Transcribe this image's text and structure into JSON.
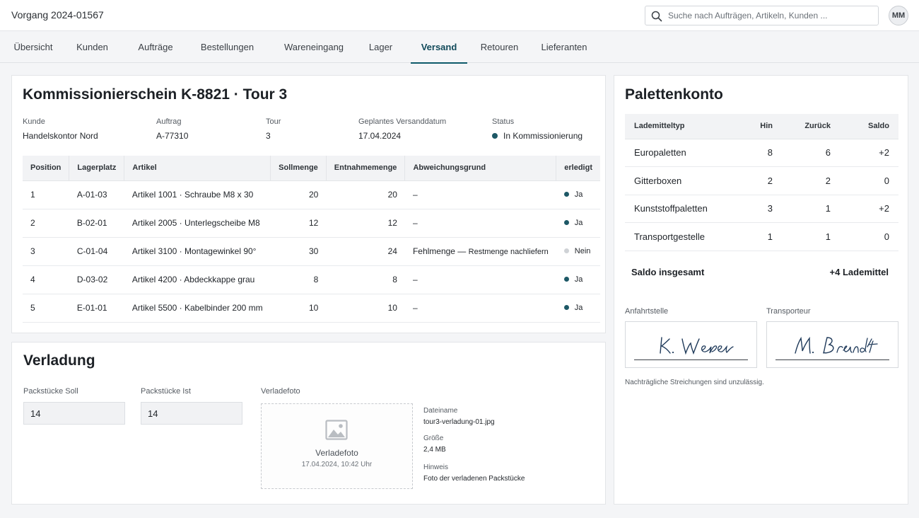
{
  "app": {
    "title": "Vorgang 2024-01567",
    "avatar_initials": "MM"
  },
  "search": {
    "placeholder": "Suche nach Aufträgen, Artikeln, Kunden ...",
    "value": ""
  },
  "tabs": [
    {
      "label": "Übersicht"
    },
    {
      "label": "Kunden"
    },
    {
      "label": "Aufträge"
    },
    {
      "label": "Bestellungen"
    },
    {
      "label": "Wareneingang"
    },
    {
      "label": "Lager"
    },
    {
      "label": "Versand",
      "active": true
    },
    {
      "label": "Retouren"
    },
    {
      "label": "Lieferanten"
    }
  ],
  "picking": {
    "title": "Kommissionierschein K-8821 · Tour 3",
    "meta": {
      "kunde_label": "Kunde",
      "kunde": "Handelskontor Nord",
      "auftrag_label": "Auftrag",
      "auftrag": "A-77310",
      "tour_label": "Tour",
      "tour": "3",
      "datum_label": "Geplantes Versanddatum",
      "datum": "17.04.2024",
      "status_label": "Status",
      "status": "In Kommissionierung"
    },
    "columns": [
      "Position",
      "Lagerplatz",
      "Artikel",
      "Sollmenge",
      "Entnahmemenge",
      "Abweichungsgrund",
      "erledigt"
    ],
    "rows": [
      {
        "pos": "1",
        "platz": "A-01-03",
        "artikel": "Artikel 1001 · Schraube M8 x 30",
        "soll": "20",
        "ist": "20",
        "grund": "–",
        "grund_note": "",
        "erledigt": "Ja",
        "done": true
      },
      {
        "pos": "2",
        "platz": "B-02-01",
        "artikel": "Artikel 2005 · Unterlegscheibe M8",
        "soll": "12",
        "ist": "12",
        "grund": "–",
        "grund_note": "",
        "erledigt": "Ja",
        "done": true
      },
      {
        "pos": "3",
        "platz": "C-01-04",
        "artikel": "Artikel 3100 · Montagewinkel 90°",
        "soll": "30",
        "ist": "24",
        "grund": "Fehlmenge — ",
        "grund_note": "Restmenge nachliefern",
        "erledigt": "Nein",
        "done": false
      },
      {
        "pos": "4",
        "platz": "D-03-02",
        "artikel": "Artikel 4200 · Abdeckkappe grau",
        "soll": "8",
        "ist": "8",
        "grund": "–",
        "grund_note": "",
        "erledigt": "Ja",
        "done": true
      },
      {
        "pos": "5",
        "platz": "E-01-01",
        "artikel": "Artikel 5500 · Kabelbinder 200 mm",
        "soll": "10",
        "ist": "10",
        "grund": "–",
        "grund_note": "",
        "erledigt": "Ja",
        "done": true
      }
    ]
  },
  "pallets": {
    "title": "Palettenkonto",
    "columns": [
      "Lademitteltyp",
      "Hin",
      "Zurück",
      "Saldo"
    ],
    "rows": [
      {
        "typ": "Europaletten",
        "hin": "8",
        "zurueck": "6",
        "saldo": "+2"
      },
      {
        "typ": "Gitterboxen",
        "hin": "2",
        "zurueck": "2",
        "saldo": "0"
      },
      {
        "typ": "Kunststoffpaletten",
        "hin": "3",
        "zurueck": "1",
        "saldo": "+2"
      },
      {
        "typ": "Transportgestelle",
        "hin": "1",
        "zurueck": "1",
        "saldo": "0"
      }
    ],
    "total_label": "Saldo insgesamt",
    "total_value": "+4 Lademittel",
    "sig_left_label": "Anfahrtstelle",
    "sig_left_name": "K. Weber",
    "sig_right_label": "Transporteur",
    "sig_right_name": "M. Brandt",
    "note": "Nachträgliche Streichungen sind unzulässig."
  },
  "loading": {
    "title": "Verladung",
    "soll_label": "Packstücke Soll",
    "soll_value": "14",
    "ist_label": "Packstücke Ist",
    "ist_value": "14",
    "photo_label": "Verladefoto",
    "photo_title": "Verladefoto",
    "photo_time": "17.04.2024, 10:42 Uhr",
    "file_label": "Dateiname",
    "file_value": "tour3-verladung-01.jpg",
    "size_label": "Größe",
    "size_value": "2,4 MB",
    "hint_label": "Hinweis",
    "hint_value": "Foto der verladenen Packstücke"
  },
  "icons": {
    "search": "search-icon",
    "photo": "image-placeholder-icon"
  },
  "colors": {
    "accent": "#0e5a6a",
    "status_done": "#1d5866",
    "status_open": "#cfd2d6"
  }
}
